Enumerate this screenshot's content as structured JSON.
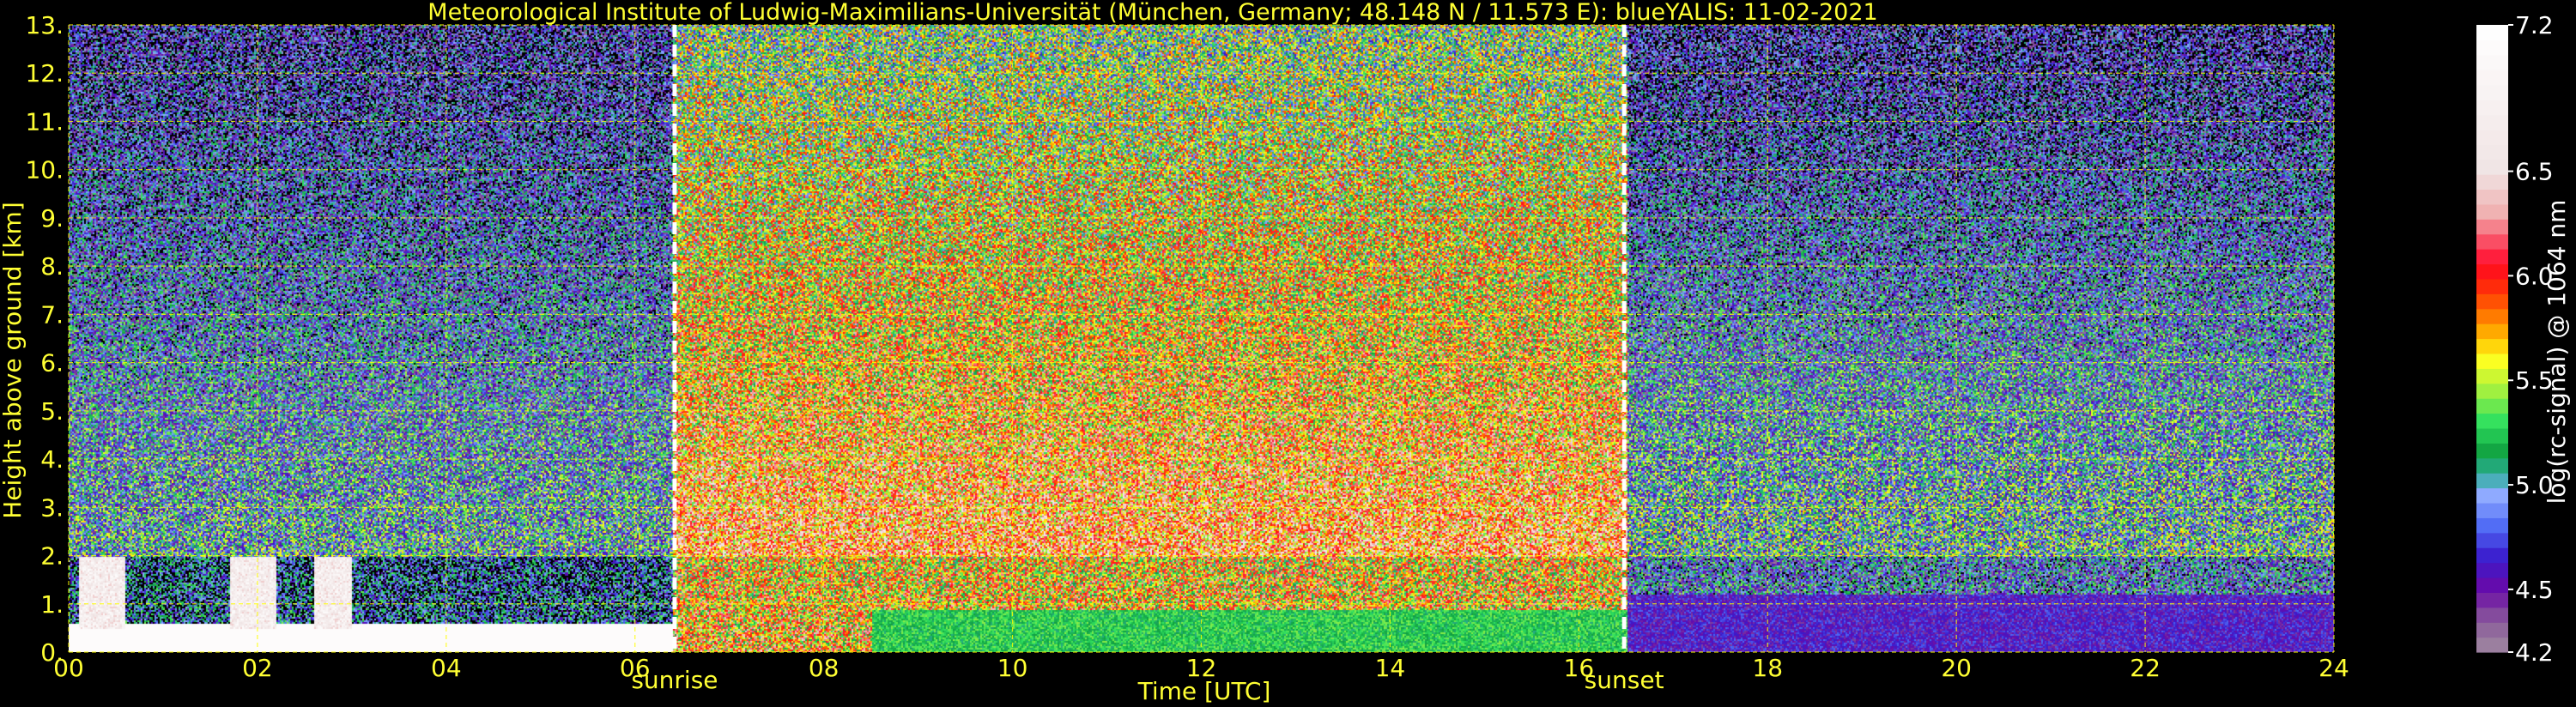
{
  "chart_data": {
    "type": "heatmap",
    "title": "Meteorological Institute of Ludwig-Maximilians-Universität (München, Germany; 48.148 N / 11.573 E):     blueYALIS: 11-02-2021",
    "xlabel": "Time [UTC]",
    "ylabel": "Height above ground [km]",
    "xlim": [
      0,
      24
    ],
    "ylim": [
      0,
      13
    ],
    "x_ticks": [
      0,
      2,
      4,
      6,
      8,
      10,
      12,
      14,
      16,
      18,
      20,
      22,
      24
    ],
    "x_tick_labels": [
      "00",
      "02",
      "04",
      "06",
      "08",
      "10",
      "12",
      "14",
      "16",
      "18",
      "20",
      "22",
      "24"
    ],
    "y_ticks": [
      0,
      1,
      2,
      3,
      4,
      5,
      6,
      7,
      8,
      9,
      10,
      11,
      12,
      13
    ],
    "y_tick_labels": [
      "0.",
      "1.",
      "2.",
      "3.",
      "4.",
      "5.",
      "6.",
      "7.",
      "8.",
      "9.",
      "10.",
      "11.",
      "12.",
      "13."
    ],
    "grid": true,
    "grid_color": "#ffff00",
    "annotations": [
      {
        "label": "sunrise",
        "x": 6.42
      },
      {
        "label": "sunset",
        "x": 16.48
      }
    ],
    "colorbar": {
      "label": "log(rc-signal) @ 1064 nm",
      "range": [
        4.2,
        7.2
      ],
      "ticks": [
        4.2,
        4.5,
        5.0,
        5.5,
        6.0,
        6.5,
        7.2
      ],
      "tick_labels": [
        "4.2",
        "4.5",
        "5.0",
        "5.5",
        "6.0",
        "6.5",
        "7.2"
      ],
      "stops": [
        {
          "v": 4.2,
          "c": "#a08aa0"
        },
        {
          "v": 4.35,
          "c": "#8a5a9a"
        },
        {
          "v": 4.5,
          "c": "#6a0aa8"
        },
        {
          "v": 4.65,
          "c": "#3a1acc"
        },
        {
          "v": 4.8,
          "c": "#4f6af5"
        },
        {
          "v": 4.95,
          "c": "#8faaff"
        },
        {
          "v": 5.05,
          "c": "#30b0a0"
        },
        {
          "v": 5.15,
          "c": "#10a040"
        },
        {
          "v": 5.3,
          "c": "#30e060"
        },
        {
          "v": 5.45,
          "c": "#a0f040"
        },
        {
          "v": 5.6,
          "c": "#ffff20"
        },
        {
          "v": 5.7,
          "c": "#ffc000"
        },
        {
          "v": 5.85,
          "c": "#ff6000"
        },
        {
          "v": 6.0,
          "c": "#ff1010"
        },
        {
          "v": 6.1,
          "c": "#ff2040"
        },
        {
          "v": 6.3,
          "c": "#f0b0b0"
        },
        {
          "v": 6.5,
          "c": "#f0e4e4"
        },
        {
          "v": 7.2,
          "c": "#ffffff"
        }
      ]
    }
  }
}
